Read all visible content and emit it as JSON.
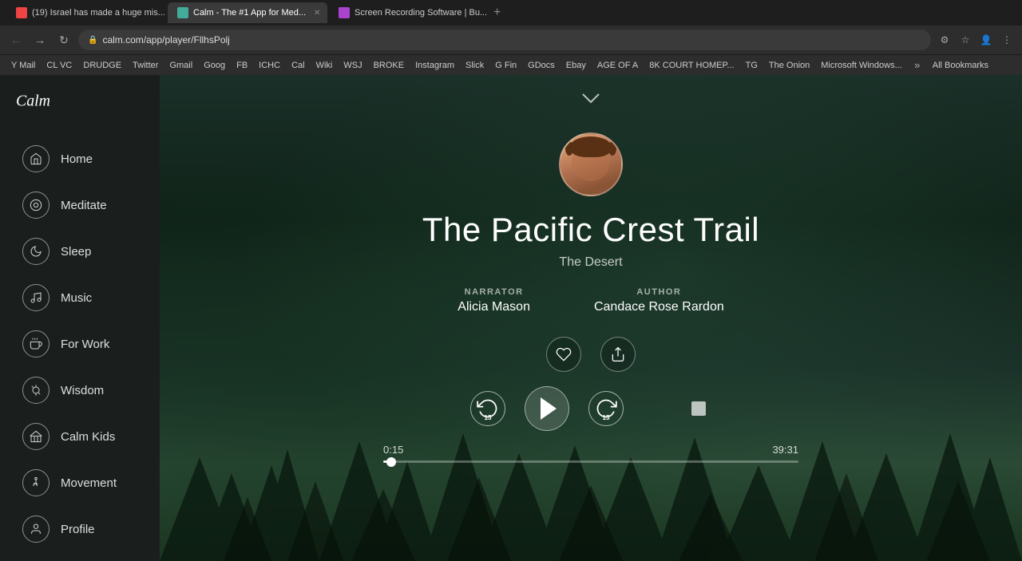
{
  "browser": {
    "tabs": [
      {
        "id": "tab1",
        "label": "(19) Israel has made a huge mis...",
        "active": false,
        "favicon_color": "#e44"
      },
      {
        "id": "tab2",
        "label": "Calm - The #1 App for Med...",
        "active": true,
        "favicon_color": "#4a9"
      },
      {
        "id": "tab3",
        "label": "Screen Recording Software | Bu...",
        "active": false,
        "favicon_color": "#a4c"
      }
    ],
    "url": "calm.com/app/player/FllhsPolj",
    "bookmarks": [
      "Y Mail",
      "CL VC",
      "DRUDGE",
      "Twitter",
      "Gmail",
      "Goog",
      "FB",
      "ICHC",
      "Cal",
      "Wiki",
      "WSJ",
      "BROKE",
      "Instagram",
      "Slick",
      "G Fin",
      "GDocs",
      "Ebay",
      "AGE OF A",
      "8K COURT HOMEP...",
      "TG",
      "The Onion",
      "Microsoft Windows..."
    ]
  },
  "sidebar": {
    "logo_text": "Calm",
    "nav_items": [
      {
        "id": "home",
        "label": "Home",
        "icon": "🏠"
      },
      {
        "id": "meditate",
        "label": "Meditate",
        "icon": "◎"
      },
      {
        "id": "sleep",
        "label": "Sleep",
        "icon": "☽"
      },
      {
        "id": "music",
        "label": "Music",
        "icon": "♪"
      },
      {
        "id": "for-work",
        "label": "For Work",
        "icon": "☕"
      },
      {
        "id": "wisdom",
        "label": "Wisdom",
        "icon": "💡"
      },
      {
        "id": "calm-kids",
        "label": "Calm Kids",
        "icon": "⚑"
      },
      {
        "id": "movement",
        "label": "Movement",
        "icon": "🏃"
      },
      {
        "id": "profile",
        "label": "Profile",
        "icon": "👤"
      }
    ]
  },
  "player": {
    "track_title": "The Pacific Crest Trail",
    "track_subtitle": "The Desert",
    "narrator_label": "NARRATOR",
    "narrator_name": "Alicia Mason",
    "author_label": "AUTHOR",
    "author_name": "Candace Rose Rardon",
    "current_time": "0:15",
    "total_time": "39:31",
    "progress_percent": 0.64,
    "skip_back_seconds": "15",
    "skip_forward_seconds": "15",
    "chevron_label": "collapse",
    "like_label": "like",
    "share_label": "share",
    "volume_label": "volume"
  }
}
